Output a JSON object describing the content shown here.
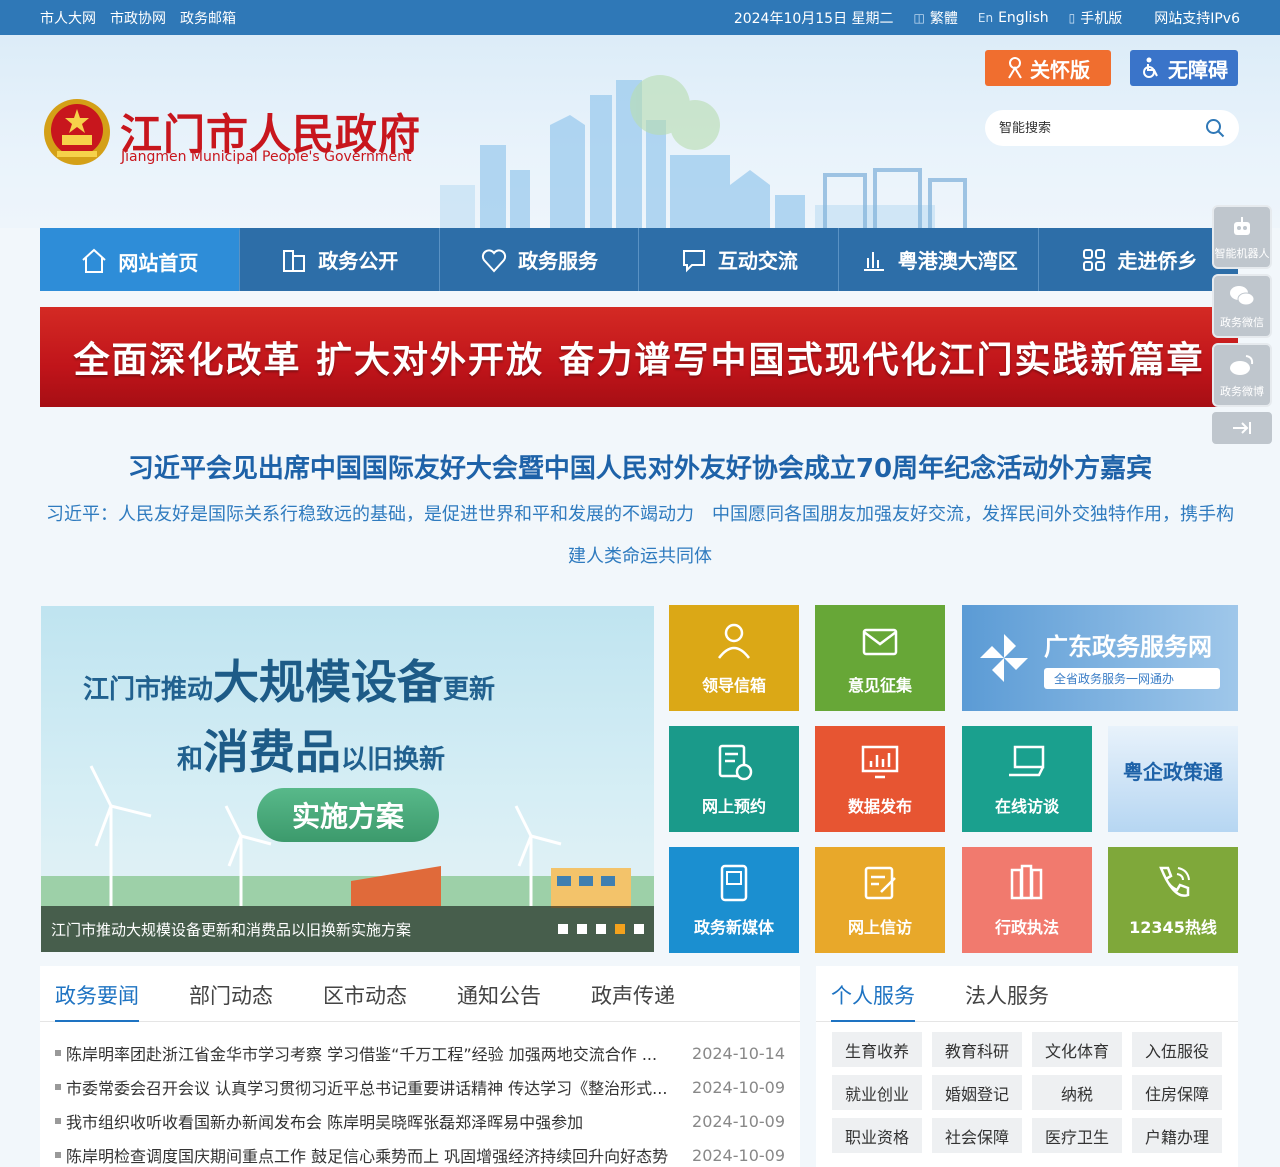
{
  "topbar": {
    "links": [
      "市人大网",
      "市政协网",
      "政务邮箱"
    ],
    "date": "2024年10月15日 星期二",
    "traditional": "繁體",
    "english": "English",
    "mobile": "手机版",
    "ipv6": "网站支持IPv6"
  },
  "header": {
    "title_cn": "江门市人民政府",
    "title_en": "Jiangmen Municipal People's Government",
    "care_label": "关怀版",
    "access_label": "无障碍",
    "search_placeholder": "智能搜索"
  },
  "nav": [
    "网站首页",
    "政务公开",
    "政务服务",
    "互动交流",
    "粤港澳大湾区",
    "走进侨乡"
  ],
  "banner": "全面深化改革 扩大对外开放 奋力谱写中国式现代化江门实践新篇章",
  "headline": {
    "title": "习近平会见出席中国国际友好大会暨中国人民对外友好协会成立70周年纪念活动外方嘉宾",
    "subtitle": "习近平：人民友好是国际关系行稳致远的基础，是促进世界和平和发展的不竭动力　中国愿同各国朋友加强友好交流，发挥民间外交独特作用，携手构建人类命运共同体"
  },
  "focus": {
    "line1_a": "江门市推动",
    "line1_b": "大规模设备",
    "line1_c": "更新",
    "line2_a": "和",
    "line2_b": "消费品",
    "line2_c": "以旧换新",
    "pill": "实施方案",
    "caption": "江门市推动大规模设备更新和消费品以旧换新实施方案"
  },
  "tiles": {
    "leader": "领导信箱",
    "opinion": "意见征集",
    "gd_title": "广东政务服务网",
    "gd_sub": "全省政务服务一网通办",
    "booking": "网上预约",
    "data": "数据发布",
    "interview": "在线访谈",
    "yqzct": "粤企政策通",
    "media": "政务新媒体",
    "petition": "网上信访",
    "law": "行政执法",
    "hotline": "12345热线"
  },
  "news": {
    "tabs": [
      "政务要闻",
      "部门动态",
      "区市动态",
      "通知公告",
      "政声传递"
    ],
    "items": [
      {
        "title": "陈岸明率团赴浙江省金华市学习考察 学习借鉴“千万工程”经验 加强两地交流合作 ...",
        "date": "2024-10-14"
      },
      {
        "title": "市委常委会召开会议 认真学习贯彻习近平总书记重要讲话精神 传达学习《整治形式...",
        "date": "2024-10-09"
      },
      {
        "title": "我市组织收听收看国新办新闻发布会 陈岸明吴晓晖张磊郑泽晖易中强参加",
        "date": "2024-10-09"
      },
      {
        "title": "陈岸明检查调度国庆期间重点工作 鼓足信心乘势而上 巩固增强经济持续回升向好态势",
        "date": "2024-10-09"
      }
    ]
  },
  "services": {
    "tabs": [
      "个人服务",
      "法人服务"
    ],
    "items": [
      "生育收养",
      "教育科研",
      "文化体育",
      "入伍服役",
      "就业创业",
      "婚姻登记",
      "纳税",
      "住房保障",
      "职业资格",
      "社会保障",
      "医疗卫生",
      "户籍办理"
    ]
  },
  "float": {
    "robot": "智能机器人",
    "wechat": "政务微信",
    "weibo": "政务微博"
  },
  "colors": {
    "topbar": "#2f78b7",
    "nav": "#2d6ea8",
    "nav_active": "#2e8dd8",
    "brand_red": "#c8161d",
    "care": "#f06e2f",
    "access": "#3a74c9"
  }
}
